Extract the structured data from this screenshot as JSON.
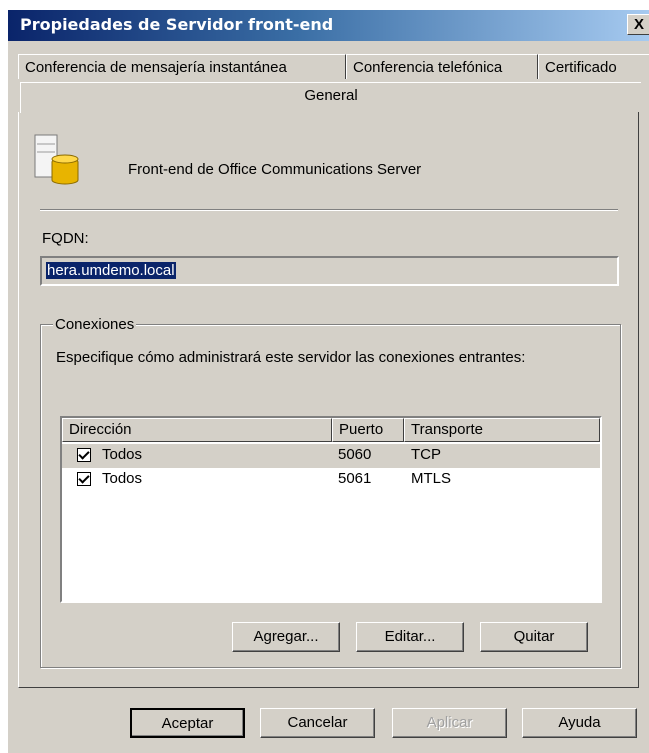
{
  "window": {
    "title": "Propiedades de Servidor front-end",
    "close_glyph": "X"
  },
  "tabs": [
    {
      "label": "Conferencia de mensajería instantánea"
    },
    {
      "label": "Conferencia telefónica"
    },
    {
      "label": "Certificado"
    },
    {
      "label": "General"
    }
  ],
  "general": {
    "server_description": "Front-end de Office Communications Server",
    "server_icon": "server-database-icon",
    "fqdn_label": "FQDN:",
    "fqdn_value": "hera.umdemo.local"
  },
  "connections": {
    "group_title": "Conexiones",
    "description": "Especifique cómo administrará este servidor las conexiones entrantes:",
    "columns": [
      "Dirección",
      "Puerto",
      "Transporte"
    ],
    "rows": [
      {
        "checked": true,
        "address": "Todos",
        "port": "5060",
        "transport": "TCP",
        "selected": true
      },
      {
        "checked": true,
        "address": "Todos",
        "port": "5061",
        "transport": "MTLS",
        "selected": false
      }
    ],
    "buttons": {
      "add": "Agregar...",
      "edit": "Editar...",
      "remove": "Quitar"
    }
  },
  "footer": {
    "ok": "Aceptar",
    "cancel": "Cancelar",
    "apply": "Aplicar",
    "help": "Ayuda"
  }
}
